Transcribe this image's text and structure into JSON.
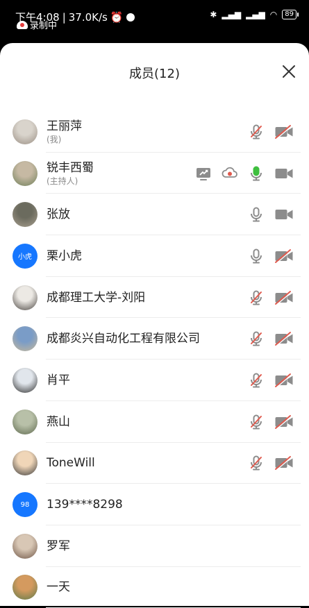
{
  "status_bar": {
    "time": "下午4:08",
    "net_speed": "37.0K/s",
    "recording_label": "录制中",
    "battery": "89"
  },
  "sheet": {
    "title": "成员(12)"
  },
  "members": [
    {
      "name": "王丽萍",
      "role": "(我)",
      "avatar_text": "",
      "mic": "muted",
      "camera": "off"
    },
    {
      "name": "锐丰西蜀",
      "role": "(主持人)",
      "avatar_text": "",
      "share_icon": true,
      "record_icon": true,
      "mic": "active",
      "camera": "on"
    },
    {
      "name": "张放",
      "role": "",
      "avatar_text": "",
      "mic": "on",
      "camera": "on"
    },
    {
      "name": "栗小虎",
      "role": "",
      "avatar_text": "小虎",
      "mic": "on",
      "camera": "off"
    },
    {
      "name": "成都理工大学-刘阳",
      "role": "",
      "avatar_text": "",
      "mic": "muted",
      "camera": "off"
    },
    {
      "name": "成都炎兴自动化工程有限公司",
      "role": "",
      "avatar_text": "",
      "mic": "muted",
      "camera": "off"
    },
    {
      "name": "肖平",
      "role": "",
      "avatar_text": "",
      "mic": "muted",
      "camera": "off"
    },
    {
      "name": "燕山",
      "role": "",
      "avatar_text": "",
      "mic": "muted",
      "camera": "off"
    },
    {
      "name": "ToneWill",
      "role": "",
      "avatar_text": "",
      "mic": "muted",
      "camera": "off"
    },
    {
      "name": "139****8298",
      "role": "",
      "avatar_text": "98",
      "mic": "none",
      "camera": "none"
    },
    {
      "name": "罗军",
      "role": "",
      "avatar_text": "",
      "mic": "none",
      "camera": "none"
    },
    {
      "name": "一天",
      "role": "",
      "avatar_text": "",
      "mic": "none",
      "camera": "none"
    }
  ],
  "colors": {
    "accent_blue": "#1677ff",
    "mic_active": "#3fbf3f",
    "muted_red": "#e05a4e",
    "icon_gray": "#8c8c8c"
  }
}
